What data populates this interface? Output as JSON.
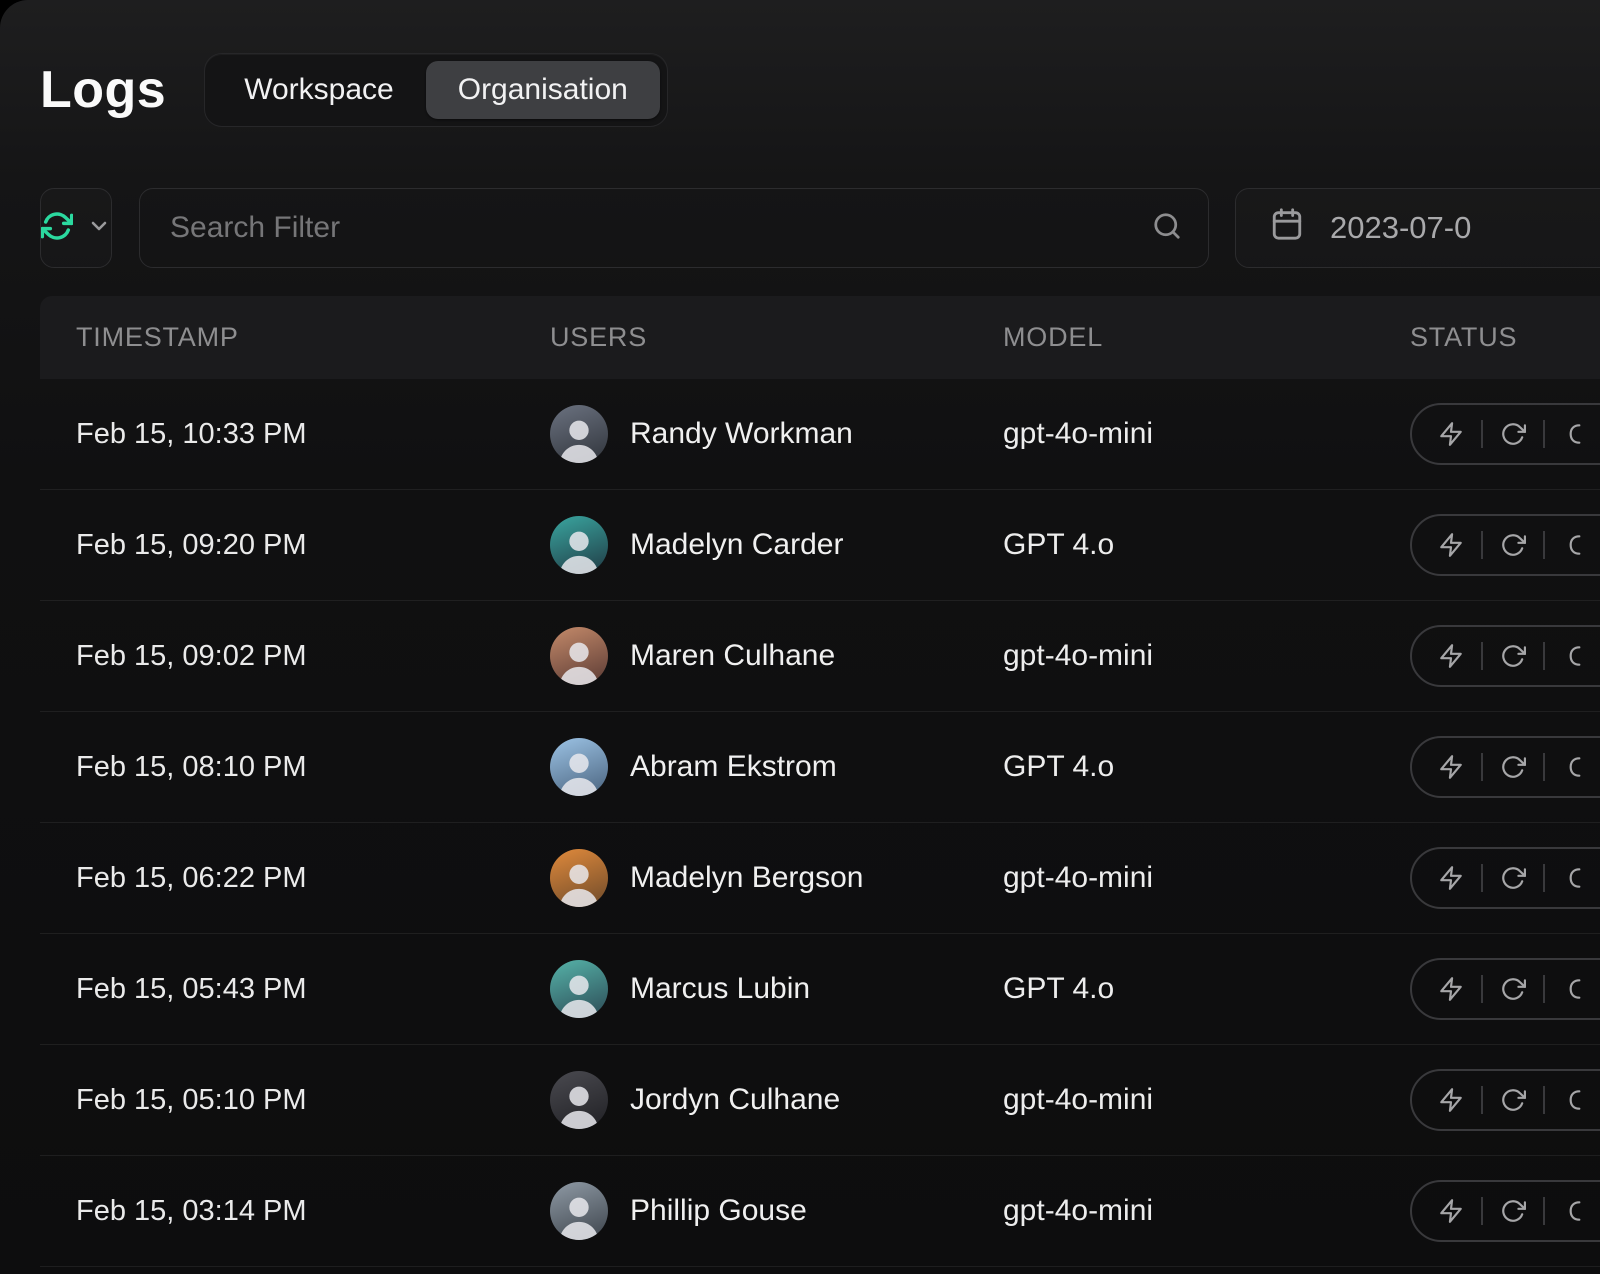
{
  "page": {
    "title": "Logs"
  },
  "tabs": {
    "workspace": "Workspace",
    "organisation": "Organisation",
    "active": "Organisation"
  },
  "toolbar": {
    "search": {
      "placeholder": "Search Filter"
    },
    "date": {
      "value": "2023-07-0"
    }
  },
  "table": {
    "columns": {
      "timestamp": "TIMESTAMP",
      "users": "USERS",
      "model": "MODEL",
      "status": "STATUS"
    },
    "rows": [
      {
        "timestamp": "Feb 15, 10:33 PM",
        "user": "Randy Workman",
        "model": "gpt-4o-mini"
      },
      {
        "timestamp": "Feb 15, 09:20 PM",
        "user": "Madelyn Carder",
        "model": "GPT 4.o"
      },
      {
        "timestamp": "Feb 15, 09:02 PM",
        "user": "Maren Culhane",
        "model": "gpt-4o-mini"
      },
      {
        "timestamp": "Feb 15, 08:10 PM",
        "user": "Abram Ekstrom",
        "model": "GPT 4.o"
      },
      {
        "timestamp": "Feb 15, 06:22 PM",
        "user": "Madelyn Bergson",
        "model": "gpt-4o-mini"
      },
      {
        "timestamp": "Feb 15, 05:43 PM",
        "user": "Marcus Lubin",
        "model": "GPT 4.o"
      },
      {
        "timestamp": "Feb 15, 05:10 PM",
        "user": "Jordyn Culhane",
        "model": "gpt-4o-mini"
      },
      {
        "timestamp": "Feb 15, 03:14 PM",
        "user": "Phillip Gouse",
        "model": "gpt-4o-mini"
      }
    ]
  },
  "icons": {
    "refresh": "refresh-icon",
    "chevron_down": "chevron-down-icon",
    "search": "search-icon",
    "calendar": "calendar-icon",
    "bolt": "bolt-icon",
    "retry": "retry-icon",
    "avatar": "user-avatar"
  },
  "colors": {
    "accent_green": "#2bd99f",
    "background": "#0d0d0e",
    "header_row": "#1b1b1d"
  }
}
